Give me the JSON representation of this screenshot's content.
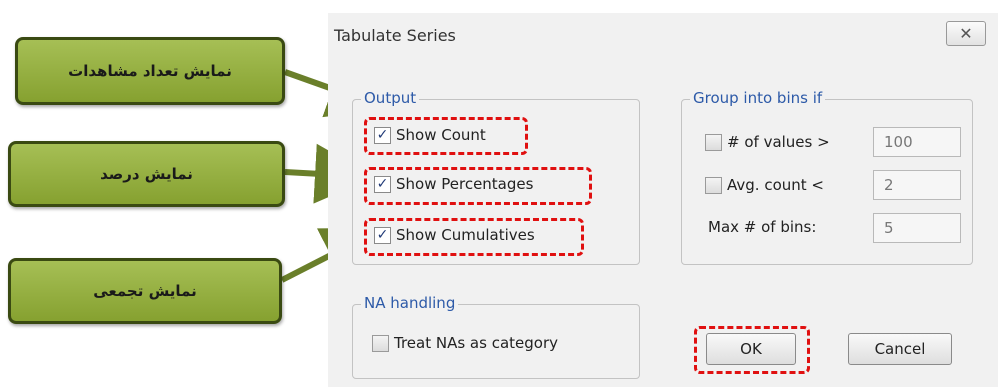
{
  "callouts": {
    "count": "نمایش تعداد مشاهدات",
    "percent": "نمایش درصد",
    "cumulative": "نمایش تجمعی"
  },
  "dialog": {
    "title": "Tabulate Series",
    "close_glyph": "✕",
    "output": {
      "legend": "Output",
      "show_count": "Show Count",
      "show_percentages": "Show Percentages",
      "show_cumulatives": "Show Cumulatives",
      "check_glyph": "✓"
    },
    "bins": {
      "legend": "Group into bins if",
      "num_values_label": "# of values >",
      "num_values_value": "100",
      "avg_count_label": "Avg. count <",
      "avg_count_value": "2",
      "max_bins_label": "Max # of bins:",
      "max_bins_value": "5"
    },
    "na": {
      "legend": "NA handling",
      "treat_na": "Treat NAs as category"
    },
    "ok_label": "OK",
    "cancel_label": "Cancel"
  },
  "colors": {
    "callout_green": "#94ad3e",
    "highlight_red": "#e01010",
    "legend_blue": "#2d5aa8"
  }
}
